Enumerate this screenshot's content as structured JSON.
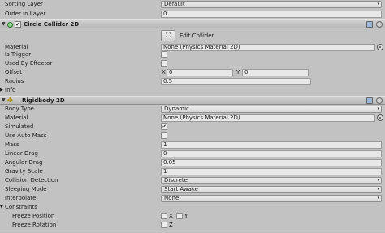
{
  "top_fields": {
    "sorting_layer_label": "Sorting Layer",
    "sorting_layer_value": "Default",
    "order_in_layer_label": "Order in Layer",
    "order_in_layer_value": "0"
  },
  "circle_collider": {
    "title": "Circle Collider 2D",
    "enabled": "✔",
    "edit_collider_label": "Edit Collider",
    "edit_icon": "edit-collider-icon",
    "material_label": "Material",
    "material_value": "None (Physics Material 2D)",
    "is_trigger_label": "Is Trigger",
    "used_by_effector_label": "Used By Effector",
    "offset_label": "Offset",
    "offset_x_label": "X",
    "offset_x_value": "0",
    "offset_y_label": "Y",
    "offset_y_value": "0",
    "radius_label": "Radius",
    "radius_value": "0.5",
    "info_label": "Info"
  },
  "rigidbody": {
    "title": "Rigidbody 2D",
    "body_type_label": "Body Type",
    "body_type_value": "Dynamic",
    "material_label": "Material",
    "material_value": "None (Physics Material 2D)",
    "simulated_label": "Simulated",
    "simulated_check": "✔",
    "use_auto_mass_label": "Use Auto Mass",
    "mass_label": "Mass",
    "mass_value": "1",
    "linear_drag_label": "Linear Drag",
    "linear_drag_value": "0",
    "angular_drag_label": "Angular Drag",
    "angular_drag_value": "0.05",
    "gravity_scale_label": "Gravity Scale",
    "gravity_scale_value": "1",
    "collision_detection_label": "Collision Detection",
    "collision_detection_value": "Discrete",
    "sleeping_mode_label": "Sleeping Mode",
    "sleeping_mode_value": "Start Awake",
    "interpolate_label": "Interpolate",
    "interpolate_value": "None",
    "constraints_label": "Constraints",
    "freeze_position_label": "Freeze Position",
    "freeze_position_x": "X",
    "freeze_position_y": "Y",
    "freeze_rotation_label": "Freeze Rotation",
    "freeze_rotation_z": "Z"
  },
  "glyphs": {
    "dropdown_arrow": "▾",
    "expanded": "▼",
    "collapsed": "▶"
  },
  "colors": {
    "panel_bg": "#c2c2c2",
    "field_bg": "#e8e8e8",
    "header_bg": "#c4c4c4"
  }
}
